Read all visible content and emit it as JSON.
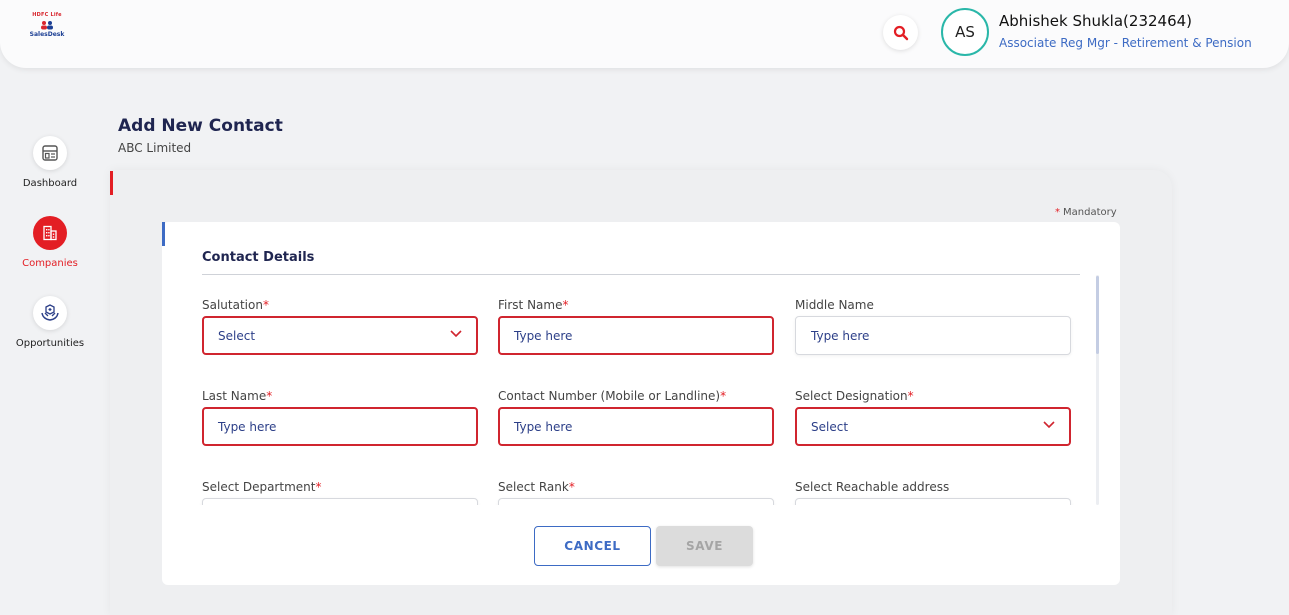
{
  "brand": {
    "logo_top": "HDFC Life",
    "logo_bottom": "SalesDesk"
  },
  "header": {
    "user_initials": "AS",
    "user_name": "Abhishek Shukla(232464)",
    "user_role": "Associate Reg Mgr - Retirement & Pension",
    "search_icon": "search-icon"
  },
  "sidebar": {
    "items": [
      {
        "label": "Dashboard",
        "icon": "dashboard-icon",
        "active": false
      },
      {
        "label": "Companies",
        "icon": "companies-icon",
        "active": true
      },
      {
        "label": "Opportunities",
        "icon": "opportunities-icon",
        "active": false
      }
    ]
  },
  "page": {
    "title": "Add New Contact",
    "subtitle": "ABC Limited",
    "mandatory_note": "Mandatory"
  },
  "form": {
    "section_title": "Contact Details",
    "fields": {
      "salutation": {
        "label": "Salutation",
        "required": "*",
        "value": "Select"
      },
      "first_name": {
        "label": "First Name",
        "required": "*",
        "placeholder": "Type here"
      },
      "middle_name": {
        "label": "Middle Name",
        "placeholder": "Type here"
      },
      "last_name": {
        "label": "Last Name",
        "required": "*",
        "placeholder": "Type here"
      },
      "contact_number": {
        "label": "Contact Number (Mobile or Landline)",
        "required": "*",
        "placeholder": "Type here"
      },
      "designation": {
        "label": "Select Designation",
        "required": "*",
        "value": "Select"
      },
      "department": {
        "label": "Select Department",
        "required": "*"
      },
      "rank": {
        "label": "Select Rank",
        "required": "*"
      },
      "reachable_address": {
        "label": "Select Reachable address"
      }
    }
  },
  "actions": {
    "cancel_label": "CANCEL",
    "save_label": "SAVE"
  },
  "colors": {
    "brand_red": "#e31e24",
    "accent_blue": "#3d6bc4",
    "navy": "#1f2550",
    "teal": "#2ab7a9"
  }
}
